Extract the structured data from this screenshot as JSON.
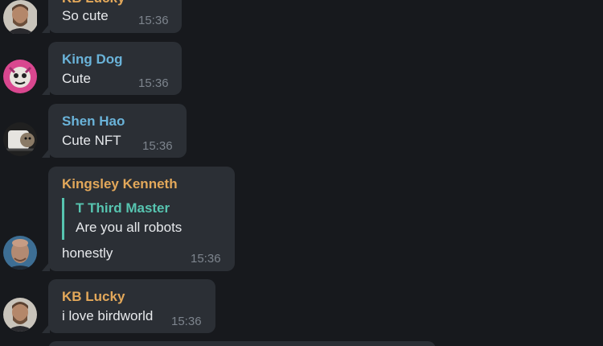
{
  "colors": {
    "background": "#17191d",
    "bubble": "#2b2f35",
    "sender_orange": "#e3a85a",
    "sender_blue": "#6ab3d9",
    "reply_green": "#57c4b0",
    "time": "#7d848d"
  },
  "messages": [
    {
      "sender": "KB Lucky",
      "text": "So cute",
      "time": "15:36",
      "avatar": "man-beard-avatar"
    },
    {
      "sender": "King Dog",
      "text": "Cute",
      "time": "15:36",
      "avatar": "pink-cartoon-avatar"
    },
    {
      "sender": "Shen Hao",
      "text": "Cute NFT",
      "time": "15:36",
      "avatar": "cat-photo-avatar"
    },
    {
      "sender": "Kingsley Kenneth",
      "reply_to": {
        "sender": "T Third Master",
        "text": "Are you all robots"
      },
      "text": "honestly",
      "time": "15:36",
      "avatar": "man-bald-avatar"
    },
    {
      "sender": "KB Lucky",
      "text": "i love birdworld",
      "time": "15:36",
      "avatar": "man-beard-avatar"
    }
  ]
}
